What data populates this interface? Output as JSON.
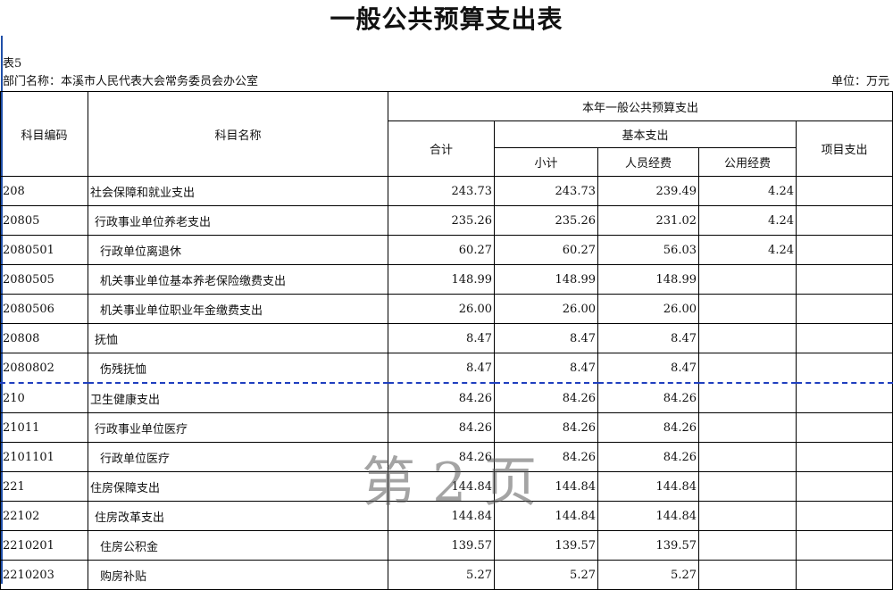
{
  "title": "一般公共预算支出表",
  "table_no": "表5",
  "department": "部门名称：本溪市人民代表大会常务委员会办公室",
  "unit": "单位：万元",
  "header": {
    "code": "科目编码",
    "name": "科目名称",
    "group": "本年一般公共预算支出",
    "total": "合计",
    "basic": "基本支出",
    "subtotal": "小计",
    "personnel": "人员经费",
    "public": "公用经费",
    "project": "项目支出"
  },
  "rows": [
    {
      "code": "208",
      "name": "社会保障和就业支出",
      "total": "243.73",
      "subtotal": "243.73",
      "personnel": "239.49",
      "public": "4.24",
      "project": ""
    },
    {
      "code": "20805",
      "name": "行政事业单位养老支出",
      "total": "235.26",
      "subtotal": "235.26",
      "personnel": "231.02",
      "public": "4.24",
      "project": ""
    },
    {
      "code": "2080501",
      "name": "行政单位离退休",
      "total": "60.27",
      "subtotal": "60.27",
      "personnel": "56.03",
      "public": "4.24",
      "project": ""
    },
    {
      "code": "2080505",
      "name": "机关事业单位基本养老保险缴费支出",
      "total": "148.99",
      "subtotal": "148.99",
      "personnel": "148.99",
      "public": "",
      "project": ""
    },
    {
      "code": "2080506",
      "name": "机关事业单位职业年金缴费支出",
      "total": "26.00",
      "subtotal": "26.00",
      "personnel": "26.00",
      "public": "",
      "project": ""
    },
    {
      "code": "20808",
      "name": "抚恤",
      "total": "8.47",
      "subtotal": "8.47",
      "personnel": "8.47",
      "public": "",
      "project": ""
    },
    {
      "code": "2080802",
      "name": "伤残抚恤",
      "total": "8.47",
      "subtotal": "8.47",
      "personnel": "8.47",
      "public": "",
      "project": ""
    },
    {
      "code": "210",
      "name": "卫生健康支出",
      "total": "84.26",
      "subtotal": "84.26",
      "personnel": "84.26",
      "public": "",
      "project": ""
    },
    {
      "code": "21011",
      "name": "行政事业单位医疗",
      "total": "84.26",
      "subtotal": "84.26",
      "personnel": "84.26",
      "public": "",
      "project": ""
    },
    {
      "code": "2101101",
      "name": "行政单位医疗",
      "total": "84.26",
      "subtotal": "84.26",
      "personnel": "84.26",
      "public": "",
      "project": ""
    },
    {
      "code": "221",
      "name": "住房保障支出",
      "total": "144.84",
      "subtotal": "144.84",
      "personnel": "144.84",
      "public": "",
      "project": ""
    },
    {
      "code": "22102",
      "name": "住房改革支出",
      "total": "144.84",
      "subtotal": "144.84",
      "personnel": "144.84",
      "public": "",
      "project": ""
    },
    {
      "code": "2210201",
      "name": "住房公积金",
      "total": "139.57",
      "subtotal": "139.57",
      "personnel": "139.57",
      "public": "",
      "project": ""
    },
    {
      "code": "2210203",
      "name": "购房补贴",
      "total": "5.27",
      "subtotal": "5.27",
      "personnel": "5.27",
      "public": "",
      "project": ""
    }
  ],
  "watermark": "第 2 页"
}
